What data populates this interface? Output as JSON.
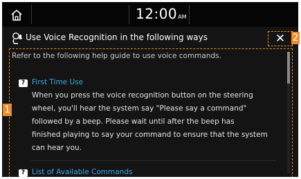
{
  "status_bar": {
    "time": "12:00",
    "ampm": "AM"
  },
  "dialog": {
    "title": "Use Voice Recognition in the following ways",
    "close_label": "✕"
  },
  "callouts": {
    "content": "1",
    "close": "2"
  },
  "help": {
    "intro": "Refer to the following help guide to use voice commands.",
    "sections": [
      {
        "title": "First Time Use",
        "lines": [
          "When you press the voice recognition button on the steering",
          "wheel, you'll hear the system say \"Please say a command\"",
          "followed by a beep. Please wait until after the beep has",
          "finished playing to say your command to ensure that the system",
          "can hear you."
        ]
      },
      {
        "title": "List of Available Commands"
      }
    ]
  },
  "colors": {
    "accent": "#f08a28",
    "link": "#3aa7e6",
    "background": "#141414"
  },
  "icons": {
    "home": "home-icon",
    "voice": "voice-recognition-icon",
    "help": "help-icon",
    "close": "close-icon"
  }
}
